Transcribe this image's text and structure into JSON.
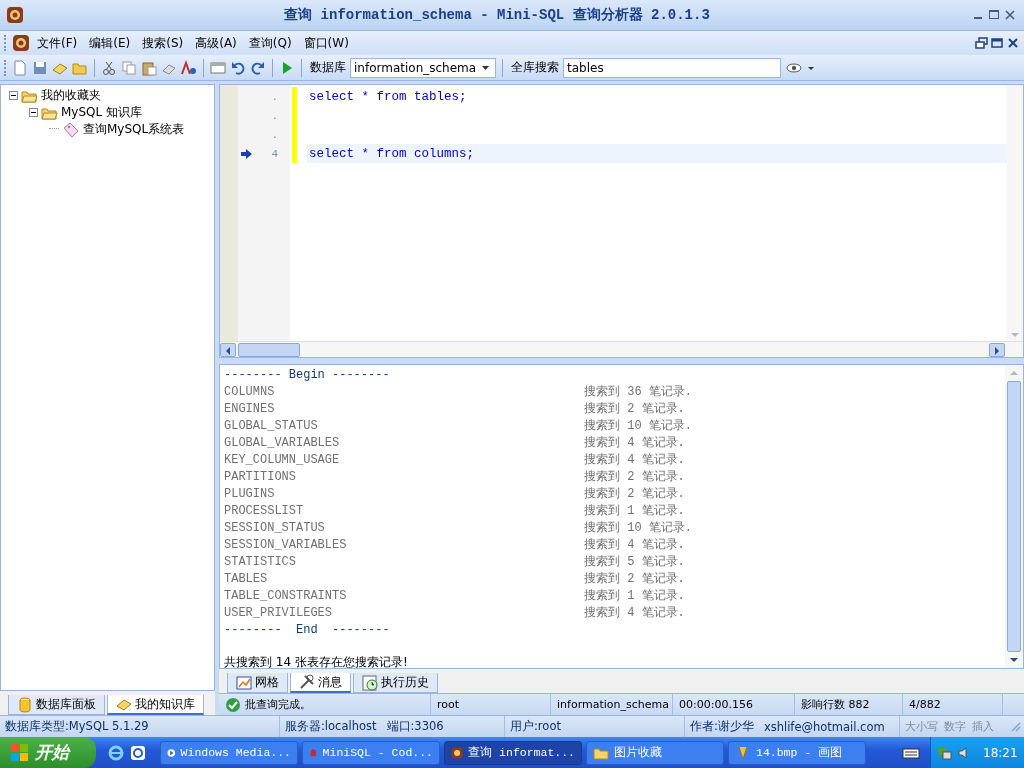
{
  "window": {
    "title": "查询 information_schema - Mini-SQL 查询分析器 2.0.1.3"
  },
  "menu": [
    {
      "label": "文件(F)"
    },
    {
      "label": "编辑(E)"
    },
    {
      "label": "搜索(S)"
    },
    {
      "label": "高级(A)"
    },
    {
      "label": "查询(Q)"
    },
    {
      "label": "窗口(W)"
    }
  ],
  "toolbar": {
    "database_label": "数据库",
    "database_value": "information_schema",
    "search_label": "全库搜索",
    "search_value": "tables"
  },
  "tree": [
    {
      "label": "我的收藏夹",
      "expanded": true,
      "children": [
        {
          "label": "MySQL 知识库",
          "expanded": true,
          "children": [
            {
              "label": "查询MySQL系统表"
            }
          ]
        }
      ]
    }
  ],
  "left_tabs": [
    {
      "label": "数据库面板",
      "selected": false
    },
    {
      "label": "我的知识库",
      "selected": true
    }
  ],
  "editor": {
    "lines": [
      {
        "number": ".",
        "text": "select * from tables;",
        "current": false
      },
      {
        "number": ".",
        "current": false
      },
      {
        "number": ".",
        "current": false
      },
      {
        "number": "4",
        "text": "select * from columns;",
        "current": true
      }
    ]
  },
  "results": {
    "header": "-------- Begin --------",
    "rows": [
      {
        "table": "COLUMNS",
        "result": "搜索到 36 笔记录."
      },
      {
        "table": "ENGINES",
        "result": "搜索到 2 笔记录."
      },
      {
        "table": "GLOBAL_STATUS",
        "result": "搜索到 10 笔记录."
      },
      {
        "table": "GLOBAL_VARIABLES",
        "result": "搜索到 4 笔记录."
      },
      {
        "table": "KEY_COLUMN_USAGE",
        "result": "搜索到 4 笔记录."
      },
      {
        "table": "PARTITIONS",
        "result": "搜索到 2 笔记录."
      },
      {
        "table": "PLUGINS",
        "result": "搜索到 2 笔记录."
      },
      {
        "table": "PROCESSLIST",
        "result": "搜索到 1 笔记录."
      },
      {
        "table": "SESSION_STATUS",
        "result": "搜索到 10 笔记录."
      },
      {
        "table": "SESSION_VARIABLES",
        "result": "搜索到 4 笔记录."
      },
      {
        "table": "STATISTICS",
        "result": "搜索到 5 笔记录."
      },
      {
        "table": "TABLES",
        "result": "搜索到 2 笔记录."
      },
      {
        "table": "TABLE_CONSTRAINTS",
        "result": "搜索到 1 笔记录."
      },
      {
        "table": "USER_PRIVILEGES",
        "result": "搜索到 4 笔记录."
      }
    ],
    "footer": "--------  End  --------",
    "summary": "共搜索到 14 张表存在您搜索记录!"
  },
  "result_tabs": [
    {
      "label": "网格",
      "selected": false
    },
    {
      "label": "消息",
      "selected": true
    },
    {
      "label": "执行历史",
      "selected": false
    }
  ],
  "query_status": {
    "message": "批查询完成。",
    "user": "root",
    "database": "information_schema",
    "elapsed": "00:00:00.156",
    "affected": "影响行数 882",
    "position": "4/882"
  },
  "status_bar": {
    "db_type": "数据库类型:MySQL 5.1.29",
    "server": "服务器:localhost",
    "port": "端口:3306",
    "user": "用户:root",
    "author": "作者:谢少华",
    "email": "xshlife@hotmail.com",
    "keys": [
      {
        "label": "大小写",
        "on": false
      },
      {
        "label": "数字",
        "on": false
      },
      {
        "label": "插入",
        "on": false
      }
    ]
  },
  "taskbar": {
    "start": "开始",
    "tasks": [
      {
        "label": "Windows Media...",
        "selected": false
      },
      {
        "label": "MiniSQL - Cod...",
        "selected": false
      },
      {
        "label": "查询 informat...",
        "selected": true
      },
      {
        "label": "图片收藏",
        "selected": false
      },
      {
        "label": "14.bmp - 画图",
        "selected": false
      }
    ],
    "clock": "18:21"
  }
}
